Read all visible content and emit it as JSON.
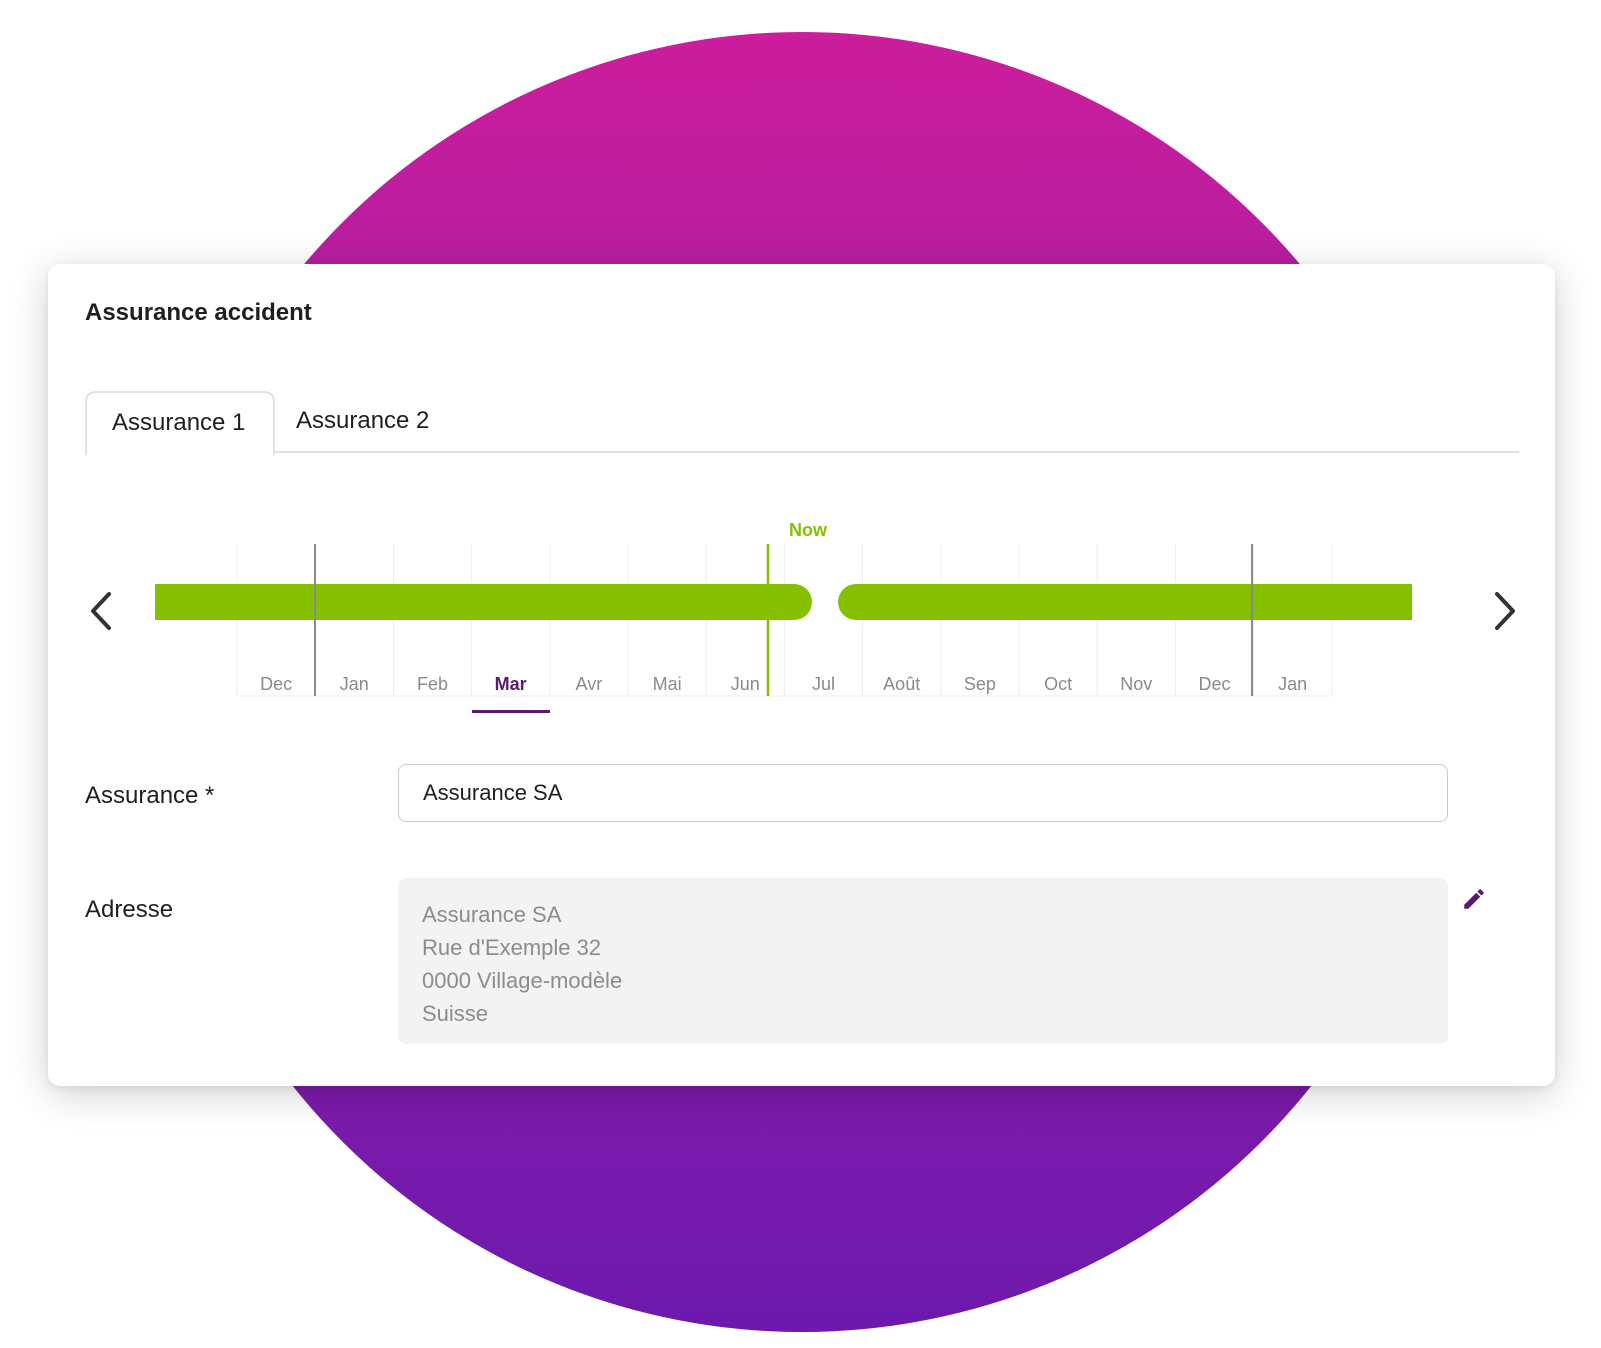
{
  "card": {
    "title": "Assurance accident"
  },
  "tabs": [
    {
      "label": "Assurance 1",
      "selected": true
    },
    {
      "label": "Assurance 2",
      "selected": false
    }
  ],
  "timeline": {
    "now_label": "Now",
    "months": [
      "Dec",
      "Jan",
      "Feb",
      "Mar",
      "Avr",
      "Mai",
      "Jun",
      "Jul",
      "Août",
      "Sep",
      "Oct",
      "Nov",
      "Dec",
      "Jan"
    ],
    "selected_month": "Mar",
    "colors": {
      "bar": "#84c000",
      "now": "#84c000",
      "selected": "#5b1a6e",
      "year_divider": "#8a8a8a",
      "grid": "#ececec"
    }
  },
  "form": {
    "assurance_label": "Assurance *",
    "assurance_value": "Assurance SA",
    "adresse_label": "Adresse",
    "address_lines": [
      "Assurance SA",
      "Rue d'Exemple 32",
      "0000 Village-modèle",
      "Suisse"
    ]
  },
  "icons": {
    "prev": "chevron-left-icon",
    "next": "chevron-right-icon",
    "edit": "pencil-icon"
  }
}
